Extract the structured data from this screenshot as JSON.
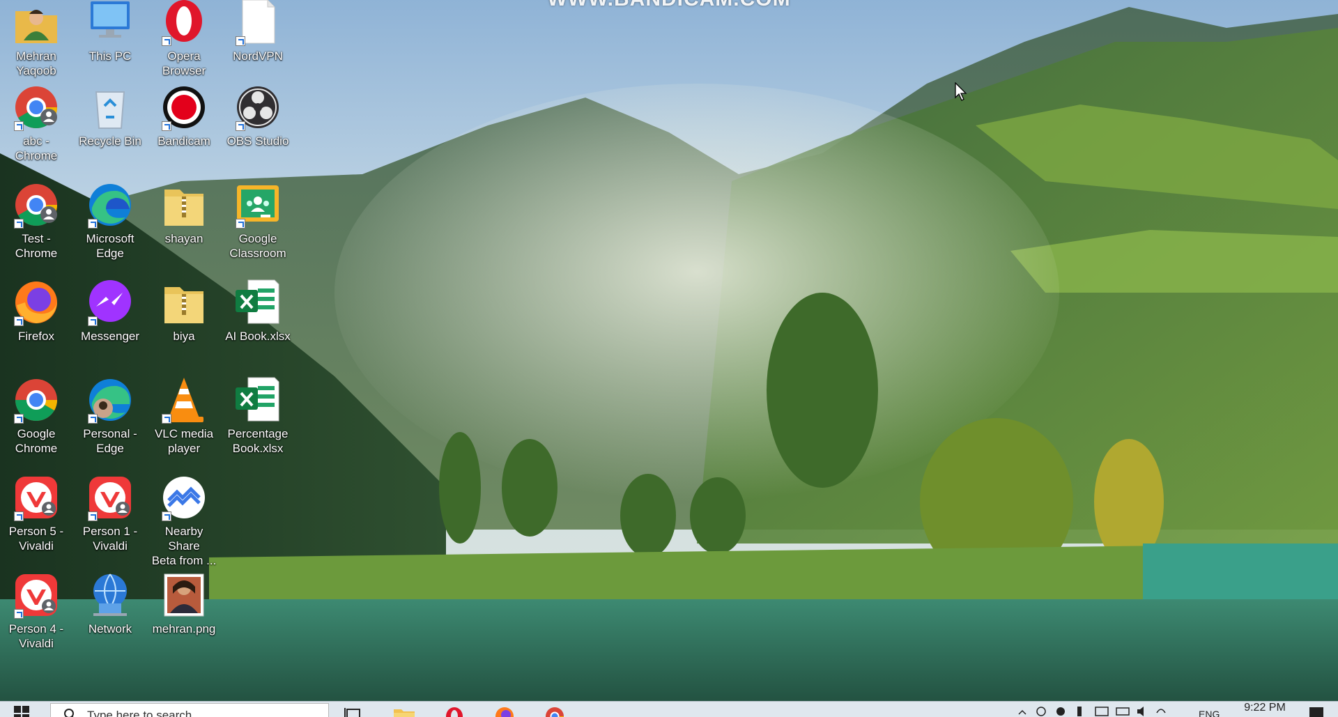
{
  "watermark": "WWW.BANDICAM.COM",
  "desktop_icons": [
    {
      "id": "mehran-yaqoob",
      "label": "Mehran\nYaqoob",
      "icon": "user-folder-icon",
      "shortcut": false
    },
    {
      "id": "this-pc",
      "label": "This PC",
      "icon": "computer-icon",
      "shortcut": false
    },
    {
      "id": "opera-browser",
      "label": "Opera\nBrowser",
      "icon": "opera-icon",
      "shortcut": true
    },
    {
      "id": "nordvpn",
      "label": "NordVPN",
      "icon": "document-icon",
      "shortcut": true
    },
    {
      "id": "abc-chrome",
      "label": "abc -\nChrome",
      "icon": "chrome-profile-icon",
      "shortcut": true
    },
    {
      "id": "recycle-bin",
      "label": "Recycle Bin",
      "icon": "recycle-bin-icon",
      "shortcut": false
    },
    {
      "id": "bandicam",
      "label": "Bandicam",
      "icon": "bandicam-icon",
      "shortcut": true
    },
    {
      "id": "obs-studio",
      "label": "OBS Studio",
      "icon": "obs-icon",
      "shortcut": true
    },
    {
      "id": "test-chrome",
      "label": "Test -\nChrome",
      "icon": "chrome-profile-icon",
      "shortcut": true
    },
    {
      "id": "microsoft-edge",
      "label": "Microsoft\nEdge",
      "icon": "edge-icon",
      "shortcut": true
    },
    {
      "id": "shayan",
      "label": "shayan",
      "icon": "zip-folder-icon",
      "shortcut": false
    },
    {
      "id": "google-classroom",
      "label": "Google\nClassroom",
      "icon": "classroom-icon",
      "shortcut": true
    },
    {
      "id": "firefox",
      "label": "Firefox",
      "icon": "firefox-icon",
      "shortcut": true
    },
    {
      "id": "messenger",
      "label": "Messenger",
      "icon": "messenger-icon",
      "shortcut": true
    },
    {
      "id": "biya",
      "label": "biya",
      "icon": "zip-folder-icon",
      "shortcut": false
    },
    {
      "id": "ai-book",
      "label": "AI Book.xlsx",
      "icon": "excel-icon",
      "shortcut": false
    },
    {
      "id": "google-chrome",
      "label": "Google\nChrome",
      "icon": "chrome-icon",
      "shortcut": true
    },
    {
      "id": "personal-edge",
      "label": "Personal -\nEdge",
      "icon": "edge-profile-icon",
      "shortcut": true
    },
    {
      "id": "vlc",
      "label": "VLC media\nplayer",
      "icon": "vlc-icon",
      "shortcut": true
    },
    {
      "id": "percentage-book",
      "label": "Percentage\nBook.xlsx",
      "icon": "excel-icon",
      "shortcut": false
    },
    {
      "id": "person5-vivaldi",
      "label": "Person 5 -\nVivaldi",
      "icon": "vivaldi-icon",
      "shortcut": true
    },
    {
      "id": "person1-vivaldi",
      "label": "Person 1 -\nVivaldi",
      "icon": "vivaldi-icon",
      "shortcut": true
    },
    {
      "id": "nearby-share",
      "label": "Nearby Share\nBeta from ...",
      "icon": "nearby-share-icon",
      "shortcut": true
    },
    {
      "id": "empty-1",
      "label": "",
      "icon": "",
      "shortcut": false
    },
    {
      "id": "person4-vivaldi",
      "label": "Person 4 -\nVivaldi",
      "icon": "vivaldi-icon",
      "shortcut": true
    },
    {
      "id": "network",
      "label": "Network",
      "icon": "network-icon",
      "shortcut": false
    },
    {
      "id": "mehran-png",
      "label": "mehran.png",
      "icon": "image-thumbnail-icon",
      "shortcut": false
    }
  ],
  "taskbar": {
    "search_placeholder": "Type here to search",
    "apps": [
      "task-view-icon",
      "file-explorer-icon",
      "opera-icon",
      "firefox-icon",
      "chrome-icon"
    ],
    "language": "ENG",
    "clock": "9:22 PM"
  },
  "colors": {
    "taskbar_bg": "#dfe7ee",
    "accent": "#1e6fd9"
  }
}
